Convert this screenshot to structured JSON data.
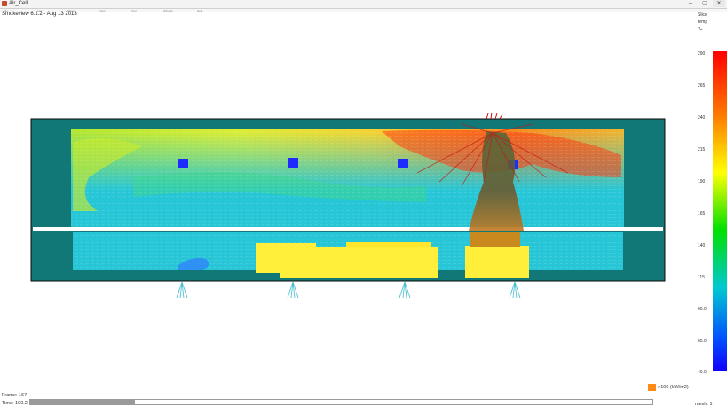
{
  "window": {
    "title": "Air_Cell",
    "minimize": "─",
    "maximize": "▢",
    "close": "✕"
  },
  "menubar": {
    "items": [
      "File",
      "Load",
      "Show",
      "View",
      "Tour",
      "Window",
      "Help"
    ]
  },
  "version_text": "Smokeview 6.1.2  -  Aug 13 2013",
  "colorbar": {
    "label_top": "Slice",
    "label_mid": "temp",
    "label_unit": "°C",
    "ticks": [
      "290",
      "265",
      "240",
      "215",
      "190",
      "165",
      "140",
      "115",
      "90.0",
      "65.0",
      "40.0"
    ],
    "colors": [
      "#ff0000",
      "#ff7a00",
      "#ffff00",
      "#00e000",
      "#00c8d0",
      "#0050ff",
      "#1000ff"
    ]
  },
  "status": {
    "frame_text": "Frame: 167",
    "time_text": "Time: 100.2",
    "mesh_text": "mesh: 1"
  },
  "timebar": {
    "progress_fraction": 0.168
  },
  "hrr_legend": {
    "label": ">100 (kW/m2)",
    "color": "#ff8a1a"
  },
  "scene_colors": {
    "wall": "#127877",
    "flow_base": "#26c6d6",
    "floor_line": "#ffffff",
    "equipment": "#ffef3a",
    "vent": "#1d2bff"
  }
}
